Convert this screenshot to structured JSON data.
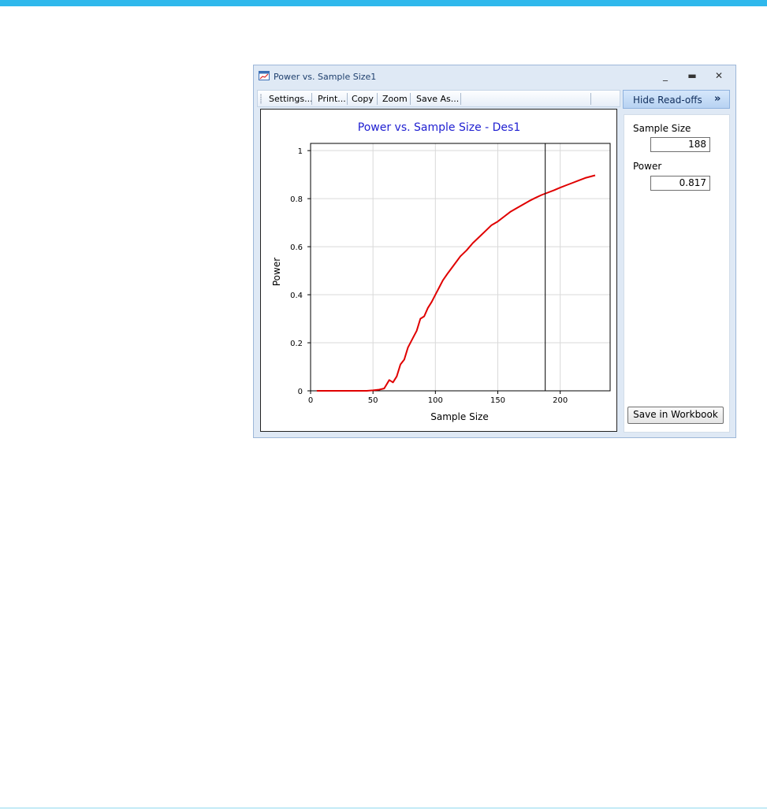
{
  "window": {
    "title": "Power vs. Sample Size1",
    "minimize": "_",
    "maximize": "▬",
    "close": "✕"
  },
  "toolbar": {
    "settings": "Settings...",
    "print": "Print...",
    "copy": "Copy",
    "zoom": "Zoom",
    "save_as": "Save As..."
  },
  "readoffs": {
    "toggle_label": "Hide Read-offs",
    "toggle_chevron": "»",
    "sample_size_label": "Sample Size",
    "sample_size_value": "188",
    "power_label": "Power",
    "power_value": "0.817",
    "save_button": "Save in Workbook"
  },
  "colors": {
    "page_accent": "#2fb8ec",
    "title_color": "#1f1fd1",
    "curve_color": "#e00000"
  },
  "chart_data": {
    "type": "line",
    "title": "Power vs. Sample Size - Des1",
    "xlabel": "Sample Size",
    "ylabel": "Power",
    "xlim": [
      0,
      240
    ],
    "ylim": [
      0,
      1.03
    ],
    "xticks": [
      0,
      50,
      100,
      150,
      200
    ],
    "yticks": [
      0,
      0.2,
      0.4,
      0.6,
      0.8,
      1
    ],
    "xtick_labels": [
      "0",
      "50",
      "100",
      "150",
      "200"
    ],
    "ytick_labels": [
      "0",
      "0.2",
      "0.4",
      "0.6",
      "0.8",
      "1"
    ],
    "grid": true,
    "readoff_x": 188,
    "series": [
      {
        "x": [
          5,
          20,
          35,
          45,
          50,
          55,
          59,
          63,
          66,
          69,
          72,
          75,
          78,
          82,
          85,
          88,
          91,
          94,
          97,
          100,
          103,
          106,
          110,
          115,
          120,
          125,
          130,
          135,
          140,
          145,
          150,
          155,
          160,
          165,
          170,
          175,
          180,
          185,
          190,
          195,
          200,
          205,
          210,
          215,
          220,
          228
        ],
        "y": [
          0,
          0,
          0,
          0,
          0.002,
          0.005,
          0.01,
          0.045,
          0.035,
          0.06,
          0.11,
          0.13,
          0.18,
          0.22,
          0.25,
          0.3,
          0.31,
          0.345,
          0.37,
          0.4,
          0.43,
          0.46,
          0.49,
          0.525,
          0.56,
          0.585,
          0.615,
          0.64,
          0.665,
          0.69,
          0.705,
          0.725,
          0.745,
          0.76,
          0.775,
          0.79,
          0.803,
          0.815,
          0.825,
          0.835,
          0.846,
          0.856,
          0.866,
          0.876,
          0.886,
          0.897
        ]
      }
    ]
  }
}
